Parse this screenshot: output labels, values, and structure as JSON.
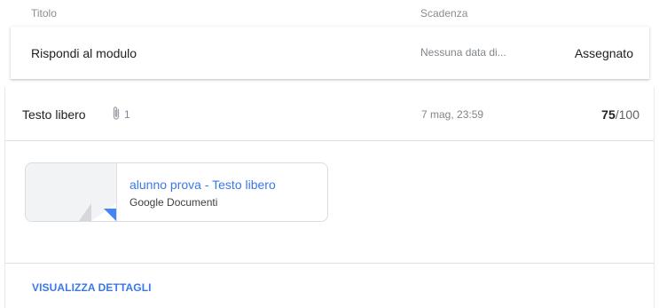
{
  "header": {
    "title_label": "Titolo",
    "due_label": "Scadenza"
  },
  "rows": [
    {
      "title": "Rispondi al modulo",
      "due": "Nessuna data di...",
      "status": "Assegnato"
    }
  ],
  "expanded": {
    "title": "Testo libero",
    "attachment_icon": "paperclip-icon",
    "attachment_count": "1",
    "due": "7 mag, 23:59",
    "grade_value": "75",
    "grade_max": "/100",
    "attachment": {
      "title": "alunno prova - Testo libero",
      "subtitle": "Google Documenti"
    },
    "details_link": "VISUALIZZA DETTAGLI"
  },
  "colors": {
    "link": "#3b78e7",
    "doc_corner": "#4285f4"
  }
}
